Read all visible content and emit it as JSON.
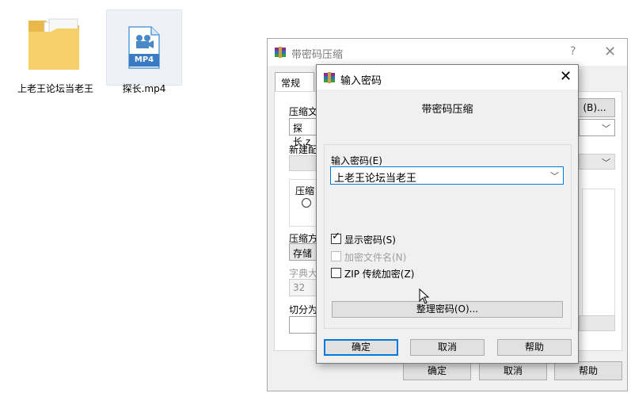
{
  "desktop": {
    "folder_label": "上老王论坛当老王",
    "file_label": "探长.mp4",
    "file_badge": "MP4"
  },
  "background_dialog": {
    "title": "带密码压缩",
    "help_glyph": "?",
    "close_glyph": "✕",
    "tab_general": "常规",
    "archive_name_label": "压缩文",
    "archive_name_value": "探长.z",
    "browse_button": "(B)...",
    "new_profile_label": "新建配",
    "format_label": "压缩",
    "method_label": "压缩方",
    "method_value": "存储",
    "dict_label": "字典大",
    "dict_value": "32",
    "split_label": "切分为",
    "ok_button": "确定",
    "cancel_button": "取消",
    "help_button": "帮助"
  },
  "password_dialog": {
    "title": "输入密码",
    "close_glyph": "✕",
    "header": "带密码压缩",
    "password_label": "输入密码(E)",
    "password_value": "上老王论坛当老王",
    "show_password": {
      "label": "显示密码(S)",
      "checked": true
    },
    "encrypt_filenames": {
      "label": "加密文件名(N)",
      "checked": false
    },
    "zip_legacy": {
      "label": "ZIP 传统加密(Z)",
      "checked": false
    },
    "organize_button": "整理密码(O)...",
    "ok_button": "确定",
    "cancel_button": "取消",
    "help_button": "帮助"
  }
}
